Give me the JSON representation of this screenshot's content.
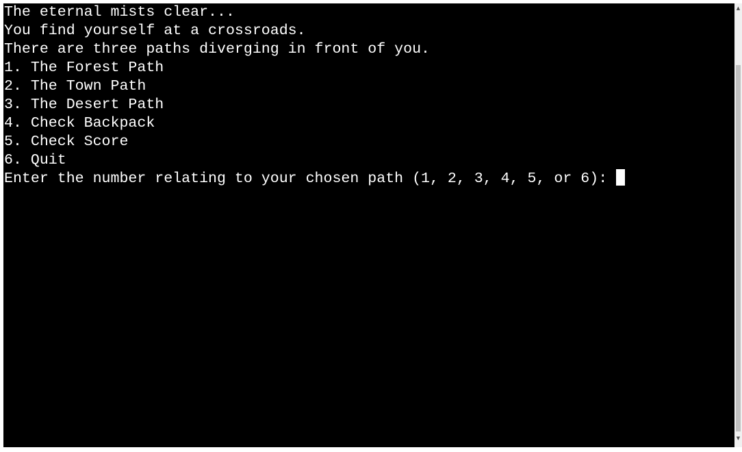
{
  "terminal": {
    "lines": [
      "The eternal mists clear...",
      "You find yourself at a crossroads.",
      "There are three paths diverging in front of you.",
      "1. The Forest Path",
      "2. The Town Path",
      "3. The Desert Path",
      "4. Check Backpack",
      "5. Check Score",
      "6. Quit"
    ],
    "prompt": "Enter the number relating to your chosen path (1, 2, 3, 4, 5, or 6): "
  },
  "scrollbar": {
    "up_arrow": "▲",
    "down_arrow": "▼"
  },
  "colors": {
    "background": "#000000",
    "text": "#ffffff",
    "cursor": "#ffffff"
  }
}
